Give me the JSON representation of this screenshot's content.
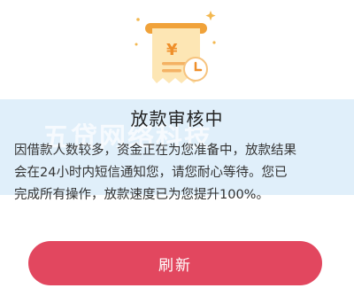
{
  "title": "放款审核中",
  "description": {
    "line1": "因借款人数较多，资金正在为您准备中，放款结果",
    "line2": "会在24小时内短信通知您，请您耐心等待。您已",
    "line3": "完成所有操作，放款速度已为您提升100%。"
  },
  "refresh_button_label": "刷新",
  "icons": {
    "receipt": "yuan-receipt-clock-icon"
  },
  "colors": {
    "accent": "#e2475f",
    "icon_orange": "#f0a23a",
    "icon_cream": "#fde6b4",
    "watermark_blue": "#d6e9f8"
  }
}
